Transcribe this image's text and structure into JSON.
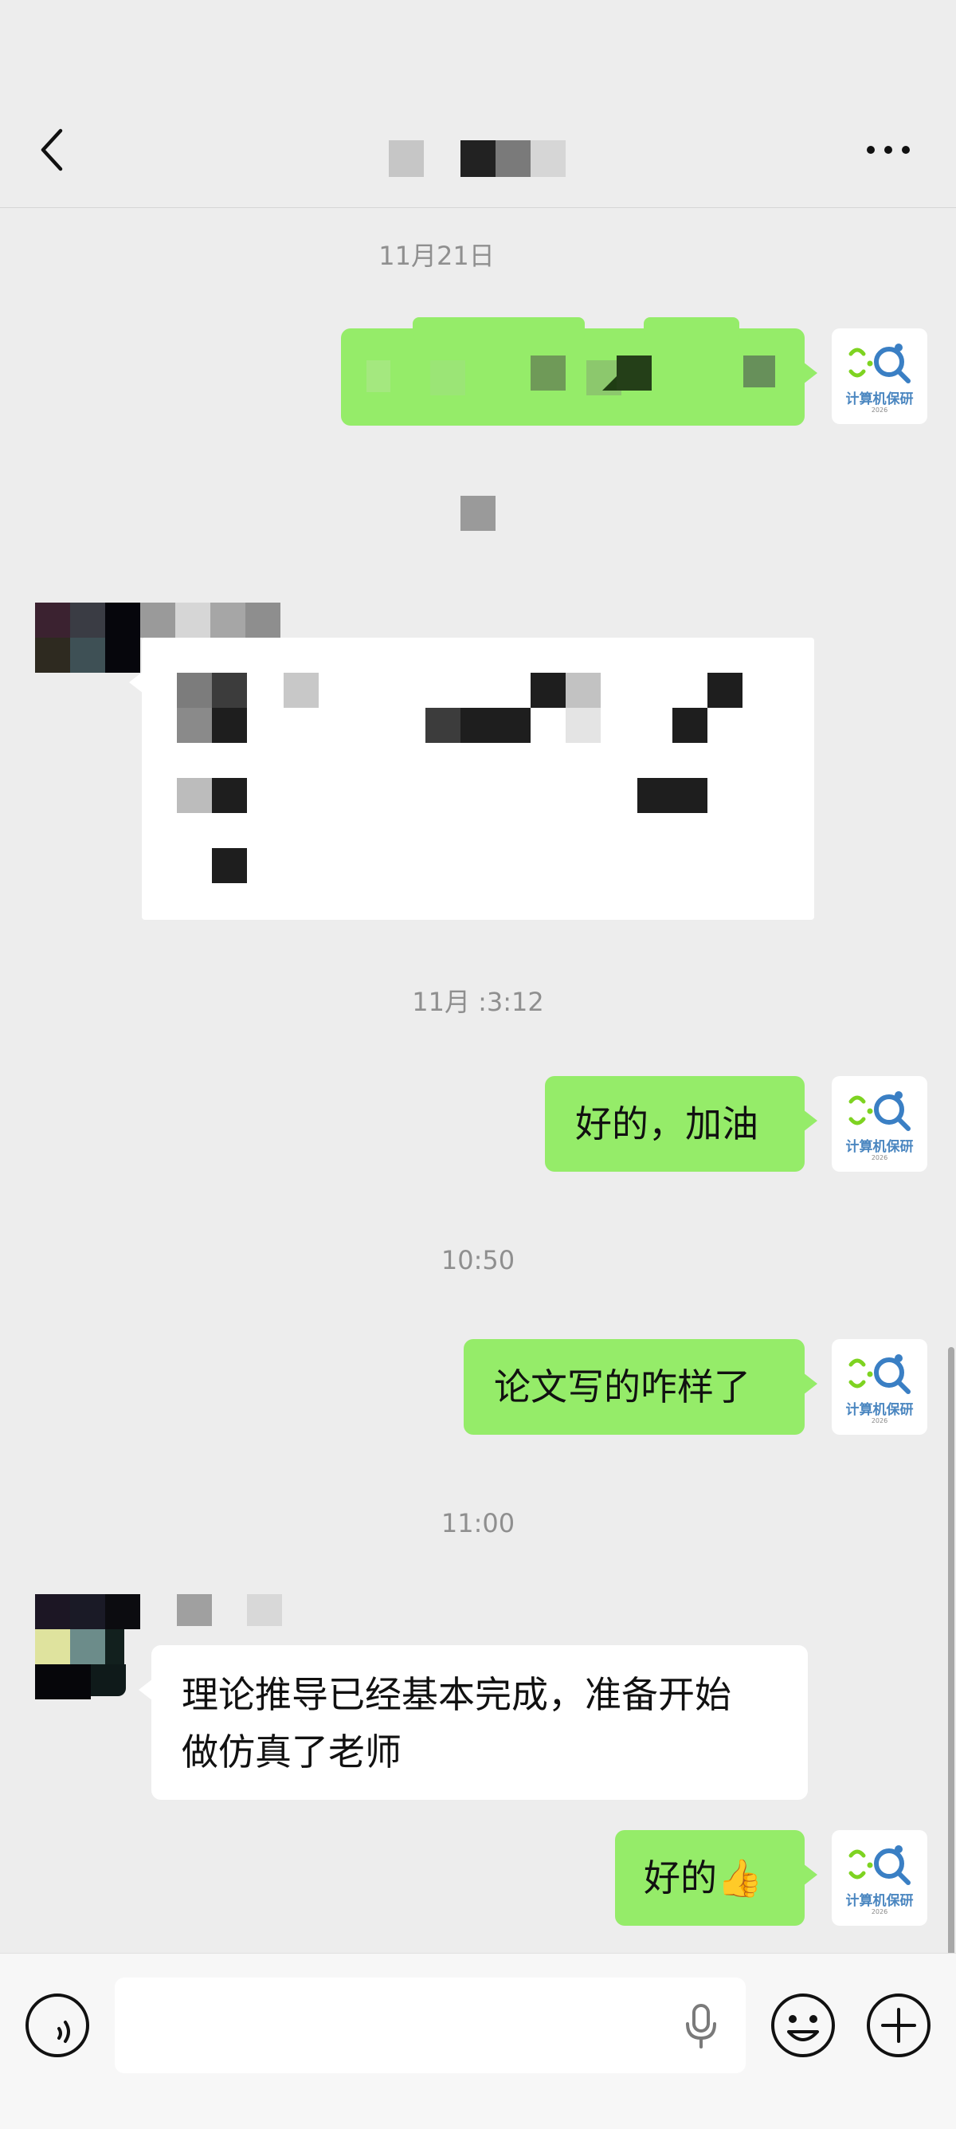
{
  "header": {
    "title": "",
    "back_icon": "chevron-left-icon",
    "more_icon": "more-dots-icon"
  },
  "timestamps": [
    "11月21日",
    "11月 :3:12",
    "10:50",
    "11:00"
  ],
  "messages": [
    {
      "side": "out",
      "text": ""
    },
    {
      "side": "in",
      "text": ""
    },
    {
      "side": "out",
      "text": "好的，加油"
    },
    {
      "side": "out",
      "text": "论文写的咋样了"
    },
    {
      "side": "in",
      "text_line1": "理论推导已经基本完成，准备开始",
      "text_line2": "做仿真了老师"
    },
    {
      "side": "out",
      "text": "好的👍"
    }
  ],
  "avatar": {
    "label": "计算机保研",
    "year": "2026"
  },
  "inputbar": {
    "voice_icon": "voice-wave-icon",
    "mic_icon": "microphone-icon",
    "emoji_icon": "emoji-icon",
    "plus_icon": "plus-circle-icon"
  },
  "colors": {
    "background": "#ededed",
    "bubble_out": "#95ec69",
    "bubble_in": "#ffffff"
  }
}
